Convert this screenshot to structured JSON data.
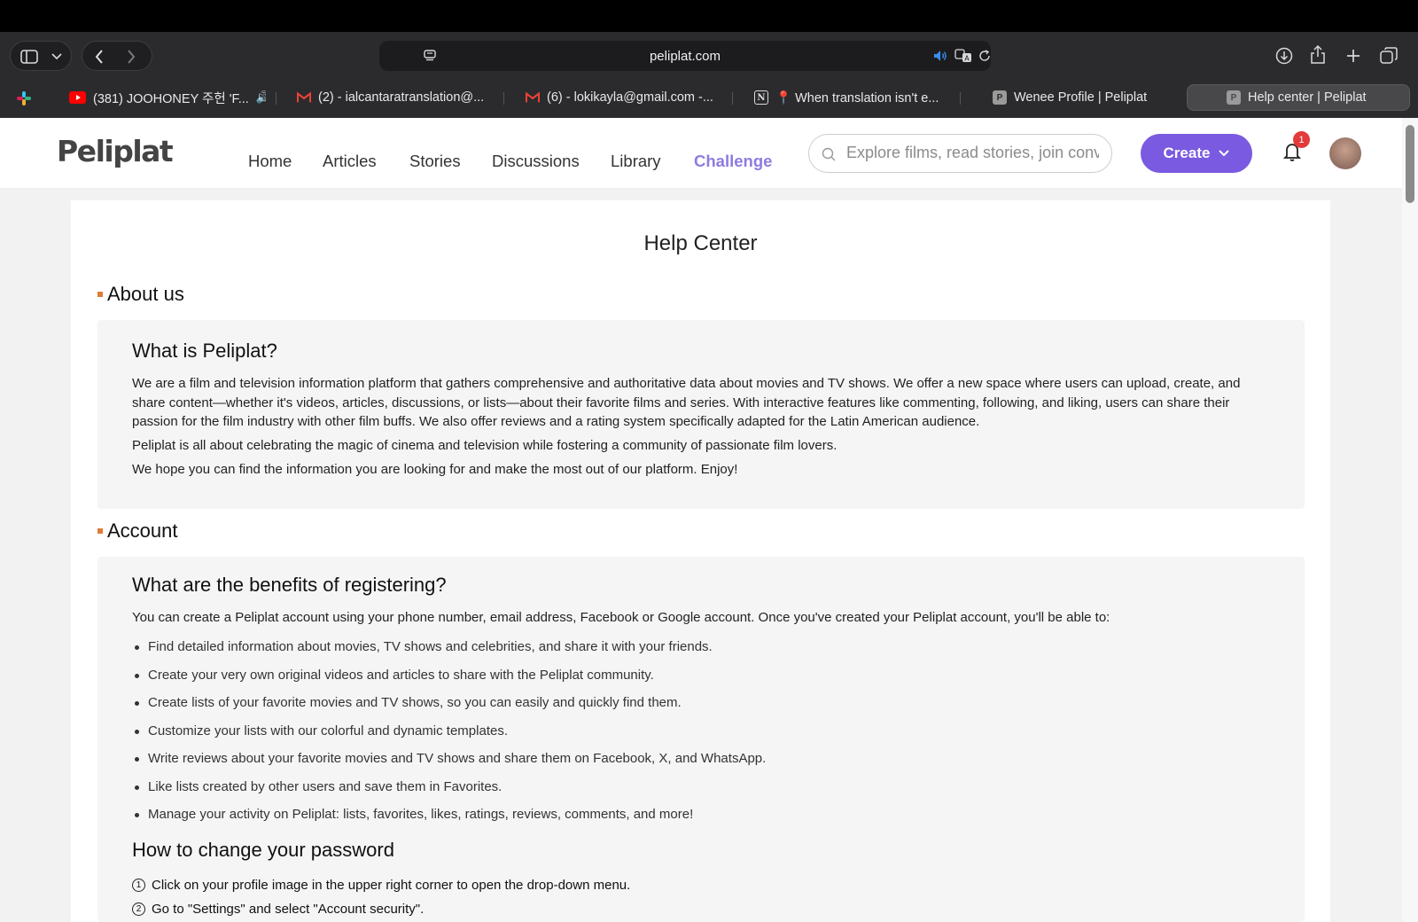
{
  "browser": {
    "url": "peliplat.com",
    "tabs": [
      {
        "label": "(381) JOOHONEY 주헌 'F...",
        "icon": "youtube-icon",
        "color": "#ff0000"
      },
      {
        "label": "(2) - ialcantaratranslation@...",
        "icon": "gmail-icon",
        "color": "#ea4335"
      },
      {
        "label": "(6) - lokikayla@gmail.com -...",
        "icon": "gmail-icon",
        "color": "#ea4335"
      },
      {
        "label": "📍 When translation isn't e...",
        "icon": "notion-icon",
        "color": "#ffffff"
      },
      {
        "label": "Wenee Profile | Peliplat",
        "icon": "peliplat-icon",
        "color": "#9a9a9a"
      },
      {
        "label": "Help center | Peliplat",
        "icon": "peliplat-icon",
        "color": "#9a9a9a",
        "active": true
      }
    ]
  },
  "header": {
    "logo": "Peliplat",
    "nav": [
      "Home",
      "Articles",
      "Stories",
      "Discussions",
      "Library",
      "Challenge"
    ],
    "search_placeholder": "Explore films, read stories, join conv",
    "create_label": "Create",
    "notification_count": "1",
    "accent_color": "#7a5ae0"
  },
  "content": {
    "title": "Help Center",
    "about": {
      "heading": "About us",
      "question": "What is Peliplat?",
      "paragraphs": [
        "We are a film and television information platform that gathers comprehensive and authoritative data about movies and TV shows. We offer a new space where users can upload, create, and share content—whether it's videos, articles, discussions, or lists—about their favorite films and series. With interactive features like commenting, following, and liking, users can share their passion for the film industry with other film buffs. We also offer reviews and a rating system specifically adapted for the Latin American audience.",
        "Peliplat is all about celebrating the magic of cinema and television while fostering a community of passionate film lovers.",
        "We hope you can find the information you are looking for and make the most out of our platform. Enjoy!"
      ]
    },
    "account": {
      "heading": "Account",
      "question": "What are the benefits of registering?",
      "intro": "You can create a Peliplat account using your phone number, email address, Facebook or Google account. Once you've created your Peliplat account, you'll be able to:",
      "benefits": [
        "Find detailed information about movies, TV shows and celebrities, and share it with your friends.",
        "Create your very own original videos and articles to share with the Peliplat community.",
        "Create lists of your favorite movies and TV shows, so you can easily and quickly find them.",
        "Customize your lists with our colorful and dynamic templates.",
        "Write reviews about your favorite movies and TV shows and share them on Facebook, X, and WhatsApp.",
        "Like lists created by other users and save them in Favorites.",
        "Manage your activity on Peliplat: lists, favorites, likes, ratings, reviews, comments, and more!"
      ],
      "password_heading": "How to change your password",
      "steps": [
        {
          "num": "1",
          "text": "Click on your profile image in the upper right corner to open the drop-down menu."
        },
        {
          "num": "2",
          "text": "Go to \"Settings\" and select \"Account security\"."
        }
      ]
    }
  }
}
